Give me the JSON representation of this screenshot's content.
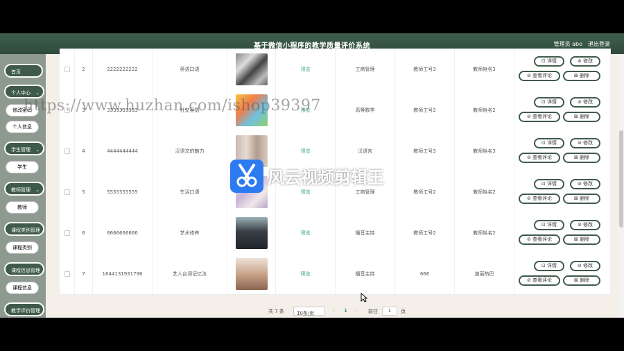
{
  "header": {
    "title": "基于微信小程序的教学质量评价系统",
    "user": "管理员 abo",
    "logout": "退出登录"
  },
  "sidebar": {
    "home": "首页",
    "personal": "个人中心",
    "change_password": "修改密码",
    "personal_info": "个人信息",
    "student_mgmt": "学生管理",
    "student": "学生",
    "teacher_mgmt": "教师管理",
    "teacher": "教师",
    "course_type_mgmt": "课程类别管理",
    "course_type": "课程类别",
    "course_info_mgmt": "课程信息管理",
    "course_info": "课程信息",
    "teaching_eval_mgmt": "教学评价管理"
  },
  "table": {
    "rows": [
      {
        "index": "2",
        "code": "2222222222",
        "name": "英语口语",
        "image": "words-collage",
        "preview": "预览",
        "category": "工商管理",
        "teacher_id": "教师工号3",
        "teacher_name": "教师姓名3"
      },
      {
        "index": "3",
        "code": "3333333333",
        "name": "社交英语",
        "image": "abcd-cartoon",
        "preview": "预览",
        "category": "高等数学",
        "teacher_id": "教师工号2",
        "teacher_name": "教师姓名2"
      },
      {
        "index": "4",
        "code": "4444444444",
        "name": "汉语文的魅力",
        "image": "fashion-photos",
        "preview": "预览",
        "category": "汉语言",
        "teacher_id": "教师工号3",
        "teacher_name": "教师姓名3"
      },
      {
        "index": "5",
        "code": "5555555555",
        "name": "生活口语",
        "image": "love-collage",
        "preview": "预览",
        "category": "工商管理",
        "teacher_id": "教师工号2",
        "teacher_name": "教师姓名2"
      },
      {
        "index": "6",
        "code": "6666666666",
        "name": "艺术修养",
        "image": "man-in-suit",
        "preview": "预览",
        "category": "播音主持",
        "teacher_id": "教师工号2",
        "teacher_name": "教师姓名2"
      },
      {
        "index": "7",
        "code": "1644131931796",
        "name": "艺人台词记忆法",
        "image": "woman-portrait",
        "preview": "预览",
        "category": "播音主持",
        "teacher_id": "666",
        "teacher_name": "迪丽热巴"
      }
    ],
    "actions": {
      "detail": "详情",
      "edit": "修改",
      "view_eval": "查看评论",
      "delete": "删除"
    }
  },
  "pager": {
    "total": "共 7 条",
    "page_size": "10条/页",
    "current": "1",
    "goto_label": "前往",
    "goto_value": "1",
    "page_unit": "页"
  },
  "overlay": {
    "watermark": "https://www.huzhan.com/ishop39397",
    "editor_name": "风云视频剪辑王"
  },
  "colors": {
    "header": "#3f5f4d",
    "sidebar_btn": "#3f5a49",
    "preview": "#3aa77a",
    "editor_logo": "#2d7bf0"
  }
}
